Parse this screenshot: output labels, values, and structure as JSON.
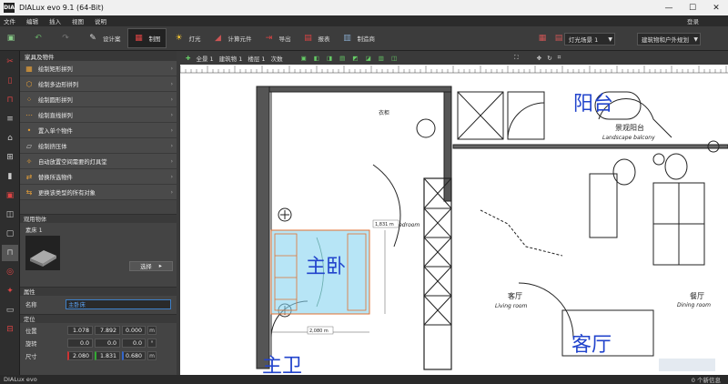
{
  "window": {
    "title": "DIALux evo 9.1  (64-Bit)",
    "logo": "DIA"
  },
  "menu": {
    "items": [
      "文件",
      "编辑",
      "插入",
      "视图",
      "说明"
    ],
    "login": "登录"
  },
  "toolbar": {
    "items": [
      {
        "label": "设计案"
      },
      {
        "label": "制图"
      },
      {
        "label": "灯光"
      },
      {
        "label": "计算元件"
      },
      {
        "label": "导出"
      },
      {
        "label": "报表"
      },
      {
        "label": "制造商"
      }
    ],
    "scene_select": "灯光场景 1",
    "view_select": "建筑物和户外规划"
  },
  "canvas_toolbar": {
    "all": "全景 1",
    "building": "建筑物 1",
    "floor": "楼层 1",
    "level": "次数"
  },
  "panel": {
    "header": "家具及物件",
    "actions": [
      "绘制矩形拼列",
      "绘制多边形拼列",
      "绘制圆形拼列",
      "绘制直线拼列",
      "置入单个物件",
      "绘制挤压体",
      "自动放置空间需要的灯具堂",
      "替换所选物件",
      "更换该类型的所有对象"
    ],
    "used_section": "观用物体",
    "bed_label": "素床 1",
    "select_button": "选择",
    "prop_section": "属性",
    "name_label": "名称",
    "name_value": "主卧床",
    "pos_section": "定位",
    "position_label": "位置",
    "rotation_label": "旋转",
    "size_label": "尺寸",
    "position": [
      "1.078",
      "7.892",
      "0.000"
    ],
    "rotation": [
      "0.0",
      "0.0",
      "0.0"
    ],
    "size": [
      "2.080",
      "1.831",
      "0.680"
    ],
    "unit_m": "m",
    "unit_deg": "°"
  },
  "plan": {
    "labels": [
      "阳台",
      "景观阳台",
      "Landscape balcony",
      "主卧",
      "客厅",
      "Living room",
      "客厅",
      "餐厅",
      "Dining room",
      "主卫",
      "衣柜",
      "Bedroom"
    ],
    "dim1": "1,831 m",
    "dim2": "2,080 m"
  },
  "status": {
    "brand": "DIALux evo",
    "info": "0 个新信息"
  }
}
